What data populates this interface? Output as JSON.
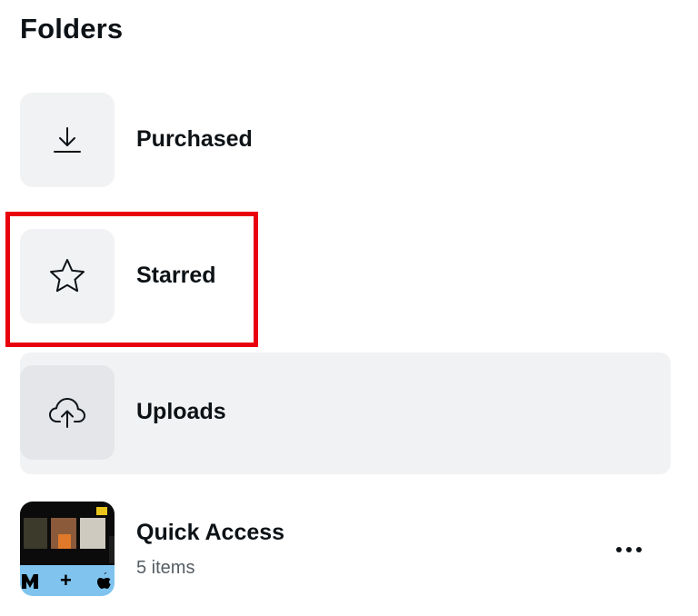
{
  "heading": "Folders",
  "folders": [
    {
      "label": "Purchased",
      "icon": "download-icon"
    },
    {
      "label": "Starred",
      "icon": "star-icon"
    },
    {
      "label": "Uploads",
      "icon": "cloud-upload-icon"
    }
  ],
  "quick_access": {
    "title": "Quick Access",
    "count": "5 items",
    "thumbnail_glyphs": {
      "plus": "+"
    }
  },
  "colors": {
    "highlight": "#e8000d",
    "tile": "#f1f2f4",
    "selected_row": "#f1f2f4",
    "text": "#0d1216",
    "muted": "#555d64"
  }
}
